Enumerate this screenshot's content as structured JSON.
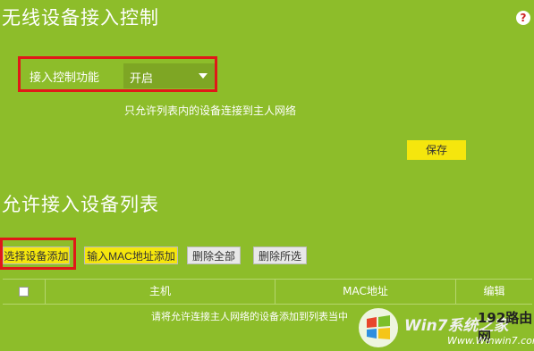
{
  "header": {
    "title": "无线设备接入控制",
    "help_label": "?"
  },
  "access_control": {
    "label": "接入控制功能",
    "selected": "开启",
    "description": "只允许列表内的设备连接到主人网络",
    "save_label": "保存"
  },
  "allow_list": {
    "title": "允许接入设备列表",
    "buttons": {
      "select_add": "选择设备添加",
      "mac_add": "输入MAC地址添加",
      "delete_all": "删除全部",
      "delete_selected": "删除所选"
    },
    "table": {
      "columns": [
        "主机",
        "MAC地址",
        "编辑"
      ],
      "empty_message": "请将允许连接主人网络的设备添加到列表当中"
    }
  },
  "watermark": {
    "brand": "Win7系统之家",
    "brand2": "192路由网",
    "url": "Www.Winwin7.com"
  },
  "colors": {
    "background": "#8dbd2a",
    "highlight_box": "#e01818",
    "primary_button": "#f5e60d"
  }
}
